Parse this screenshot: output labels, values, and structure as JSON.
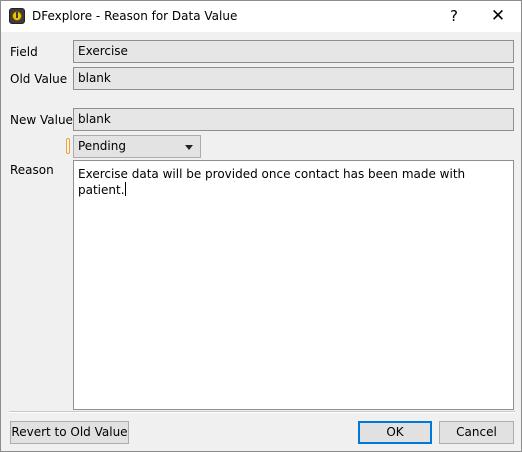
{
  "window": {
    "title": "DFexplore - Reason for Data Value",
    "help_glyph": "?",
    "close_glyph": "✕",
    "icon": "dfexplore-clock-icon"
  },
  "form": {
    "field_label": "Field",
    "field_value": "Exercise",
    "old_value_label": "Old Value",
    "old_value": "blank",
    "new_value_label": "New Value",
    "new_value": "blank",
    "status_selected": "Pending",
    "reason_label": "Reason",
    "reason_text": "Exercise data will be provided once contact has been made with patient."
  },
  "buttons": {
    "revert_label": "Revert to Old Value",
    "ok_label": "OK",
    "cancel_label": "Cancel"
  },
  "colors": {
    "status_marker": "#e8a24a",
    "default_button_border": "#0078d7"
  }
}
